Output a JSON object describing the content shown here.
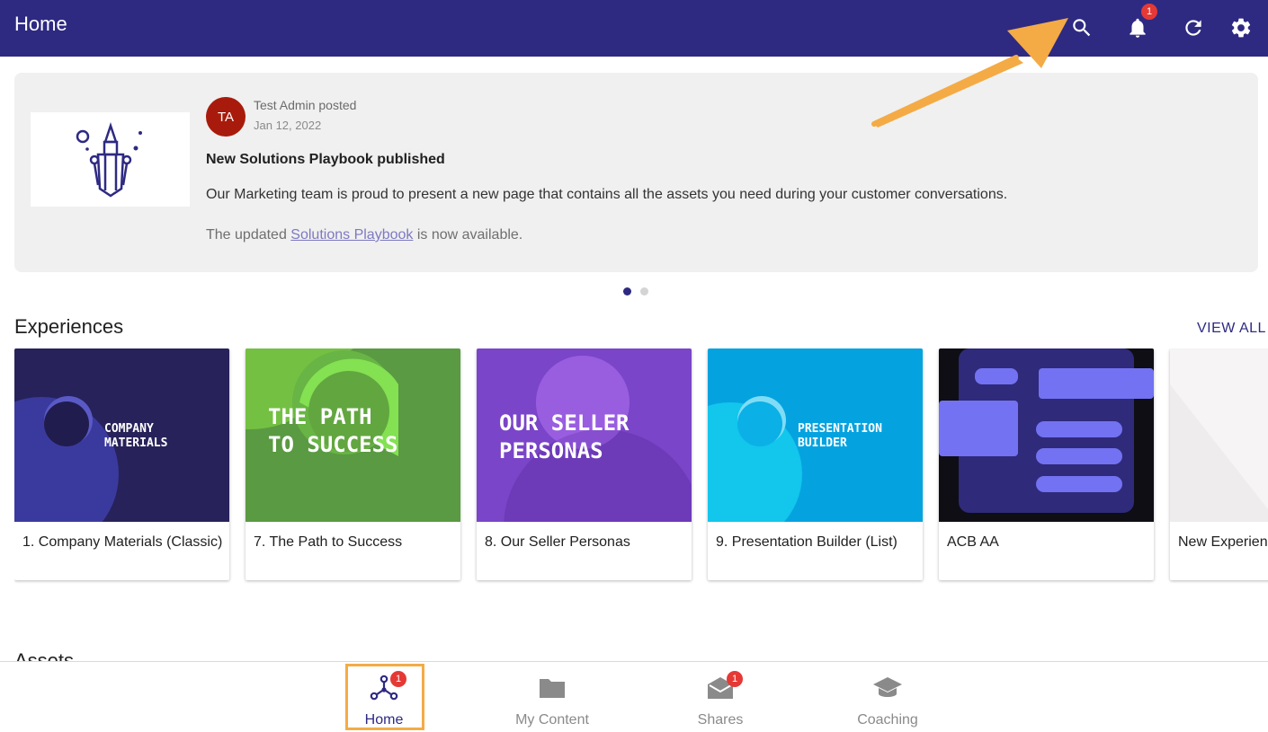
{
  "header": {
    "title": "Home",
    "notifications_count": "1",
    "icons": [
      "search-icon",
      "bell-icon",
      "refresh-icon",
      "gear-icon"
    ]
  },
  "announcement": {
    "avatar_initials": "TA",
    "poster": "Test Admin posted",
    "date": "Jan 12, 2022",
    "title": "New Solutions Playbook published",
    "body": "Our Marketing team is proud to present a new page that contains all the assets you need during your customer conversations.",
    "footer_prefix": "The updated ",
    "footer_link": "Solutions Playbook",
    "footer_suffix": " is now available.",
    "carousel_pages": 2,
    "carousel_current": 1
  },
  "experiences": {
    "title": "Experiences",
    "view_all": "VIEW ALL",
    "items": [
      {
        "name": "1. Company Materials (Classic)",
        "art_text": "COMPANY\nMATERIALS"
      },
      {
        "name": "7. The Path to Success",
        "art_text": "THE PATH\nTO SUCCESS"
      },
      {
        "name": "8. Our Seller Personas",
        "art_text": "OUR SELLER\nPERSONAS"
      },
      {
        "name": "9. Presentation Builder (List)",
        "art_text": "PRESENTATION\nBUILDER"
      },
      {
        "name": "ACB AA",
        "art_text": ""
      },
      {
        "name": "New Experienc",
        "art_text": ""
      }
    ]
  },
  "bottom_nav": {
    "items": [
      {
        "label": "Home",
        "icon": "hub-icon",
        "badge": "1",
        "active": true
      },
      {
        "label": "My Content",
        "icon": "folder-icon",
        "badge": "",
        "active": false
      },
      {
        "label": "Shares",
        "icon": "envelope-icon",
        "badge": "1",
        "active": false
      },
      {
        "label": "Coaching",
        "icon": "graduation-cap-icon",
        "badge": "",
        "active": false
      }
    ]
  },
  "colors": {
    "header_bg": "#2e2a82",
    "badge": "#e53935",
    "avatar": "#a81b0c",
    "highlight": "#f4ab45"
  }
}
